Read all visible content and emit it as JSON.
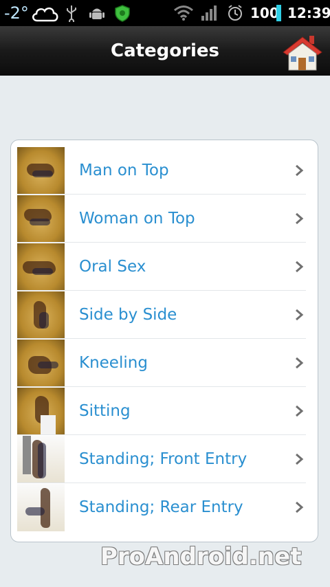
{
  "status_bar": {
    "temperature": "-2°",
    "battery_percent": "100",
    "time": "12:39",
    "icons": [
      "cloud-icon",
      "usb-icon",
      "android-debug-icon",
      "shield-icon",
      "wifi-icon",
      "signal-icon",
      "alarm-icon",
      "battery-icon"
    ]
  },
  "header": {
    "title": "Categories",
    "home_icon": "home-icon"
  },
  "categories": [
    {
      "label": "Man on Top"
    },
    {
      "label": "Woman on Top"
    },
    {
      "label": "Oral Sex"
    },
    {
      "label": "Side by Side"
    },
    {
      "label": "Kneeling"
    },
    {
      "label": "Sitting"
    },
    {
      "label": "Standing; Front Entry"
    },
    {
      "label": "Standing; Rear Entry"
    }
  ],
  "watermark": "ProAndroid.net",
  "colors": {
    "accent_text": "#2a8fd0",
    "background": "#e7ecef",
    "titlebar": "#1a1a1a"
  }
}
